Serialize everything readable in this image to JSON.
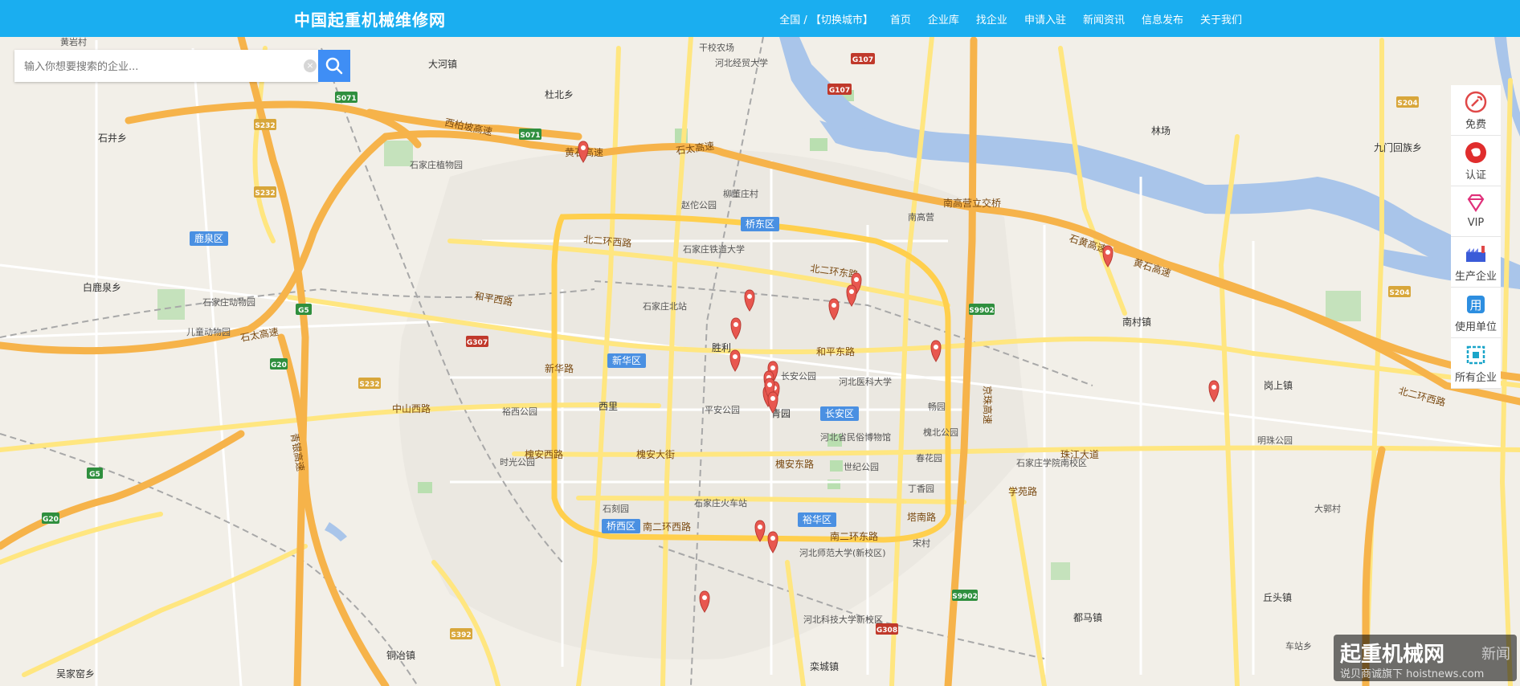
{
  "header": {
    "logo": "中国起重机械维修网",
    "nav": [
      "全国 / 【切换城市】",
      "首页",
      "企业库",
      "找企业",
      "申请入驻",
      "新闻资讯",
      "信息发布",
      "关于我们"
    ]
  },
  "search": {
    "placeholder": "输入你想要搜索的企业..."
  },
  "sidebar": [
    {
      "label": "免费",
      "icon": "wrench-icon"
    },
    {
      "label": "认证",
      "icon": "map-china-icon"
    },
    {
      "label": "VIP",
      "icon": "diamond-icon"
    },
    {
      "label": "生产企业",
      "icon": "factory-icon"
    },
    {
      "label": "使用单位",
      "icon": "use-icon"
    },
    {
      "label": "所有企业",
      "icon": "grid-icon"
    }
  ],
  "watermark": {
    "title": "起重机械网",
    "sub": "说贝商诚旗下  hoistnews.com",
    "tag": "新闻"
  },
  "map": {
    "districts": [
      "鹿泉区",
      "桥东区",
      "新华区",
      "长安区",
      "裕华区",
      "桥西区"
    ],
    "roads": [
      "西柏坡高速",
      "黄石高速",
      "石太高速",
      "北二环西路",
      "北二环东路",
      "南高营立交桥",
      "石黄高速",
      "黄石高速",
      "和平西路",
      "和平东路",
      "新华路",
      "中山西路",
      "槐安西路",
      "槐安东路",
      "槐安大街",
      "珠江大道",
      "南二环西路",
      "南二环东路",
      "塔南路",
      "学苑路",
      "京珠高速",
      "青银高速",
      "石太高速",
      "北二环西路"
    ],
    "places": [
      "黄岩村",
      "大河镇",
      "杜北乡",
      "干校农场",
      "河北经贸大学",
      "石家庄植物园",
      "石家庄动物园",
      "儿童动物园",
      "石家庄铁道大学",
      "石家庄北站",
      "河北医科大学",
      "石家庄火车站",
      "河北省民俗博物馆",
      "河北师范大学(新校区)",
      "河北科技大学新校区",
      "胜利",
      "长安公园",
      "世纪公园",
      "青园",
      "西里",
      "林场",
      "南村镇",
      "岗上镇",
      "丘头镇",
      "都马镇",
      "铜冶镇",
      "吴家窑乡",
      "白鹿泉乡",
      "石井乡",
      "九门回族乡",
      "南高营",
      "畅园",
      "裕西公园",
      "平安公园",
      "时光公园",
      "石刻园",
      "柳董庄村",
      "赵佗公园",
      "槐北公园",
      "春花园",
      "丁香园",
      "明珠公园",
      "石家庄学院南校区",
      "栾城镇",
      "宋村",
      "大郭村",
      "车站乡"
    ],
    "shields": [
      "S071",
      "S071",
      "G107",
      "G107",
      "S232",
      "S232",
      "S232",
      "G5",
      "G5",
      "G20",
      "G20",
      "G307",
      "S9902",
      "S9902",
      "G308",
      "S392",
      "S204",
      "S204"
    ],
    "marker_count": 20
  }
}
